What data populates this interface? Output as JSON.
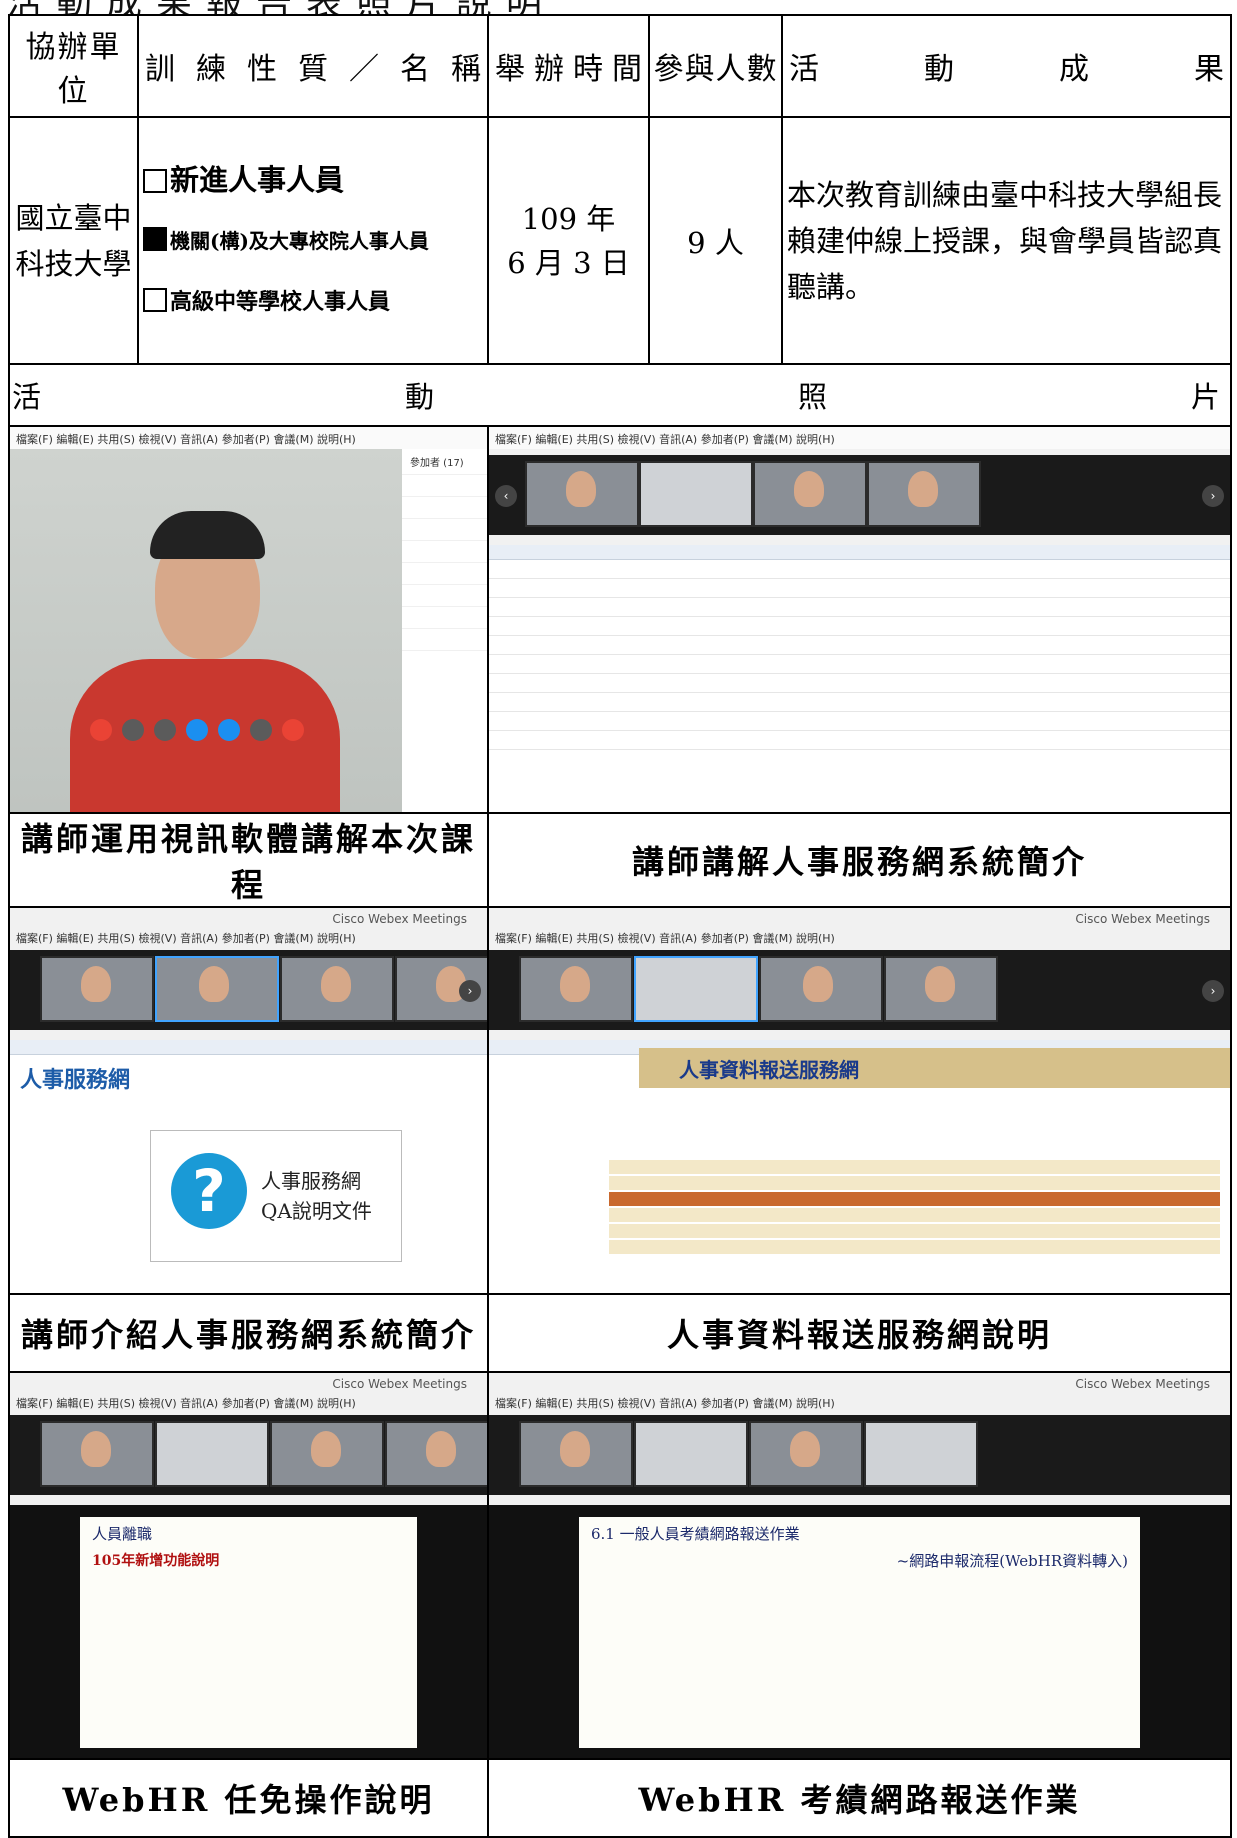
{
  "header": {
    "unit": "協辦單位",
    "nature": "訓練性質／名稱",
    "time": "舉辦時間",
    "people": "參與人數",
    "result": "活動成果"
  },
  "row": {
    "unit_line1": "國立臺中",
    "unit_line2": "科技大學",
    "options": [
      {
        "label": "新進人事人員",
        "checked": false
      },
      {
        "label": "機關(構)及大專校院人事人員",
        "checked": true
      },
      {
        "label": "高級中等學校人事人員",
        "checked": false
      }
    ],
    "time_line1": "109 年",
    "time_line2": "6 月 3 日",
    "people": "9 人",
    "result": "本次教育訓練由臺中科技大學組長賴建仲線上授課，與會學員皆認真聽講。"
  },
  "photo_header": "活動照片",
  "captions": [
    "講師運用視訊軟體講解本次課程",
    "講師講解人事服務網系統簡介",
    "講師介紹人事服務網系統簡介",
    "人事資料報送服務網說明",
    "WebHR 任免操作說明",
    "WebHR 考績網路報送作業"
  ],
  "screens": {
    "app_title": "Cisco Webex Meetings",
    "menu": "檔案(F) 編輯(E) 共用(S) 檢視(V) 音訊(A) 參加者(P) 會議(M) 說明(H)",
    "participants_title": "參加者 (17)",
    "qa_line1": "人事服務網",
    "qa_line2": "QA說明文件",
    "site_title": "人事服務網",
    "report_title": "人事資料報送服務網",
    "slide1_title": "人員離職",
    "slide1_sub": "105年新增功能說明",
    "slide2_title": "6.1 一般人員考績網路報送作業",
    "slide2_sub": "~網路申報流程(WebHR資料轉入)"
  }
}
